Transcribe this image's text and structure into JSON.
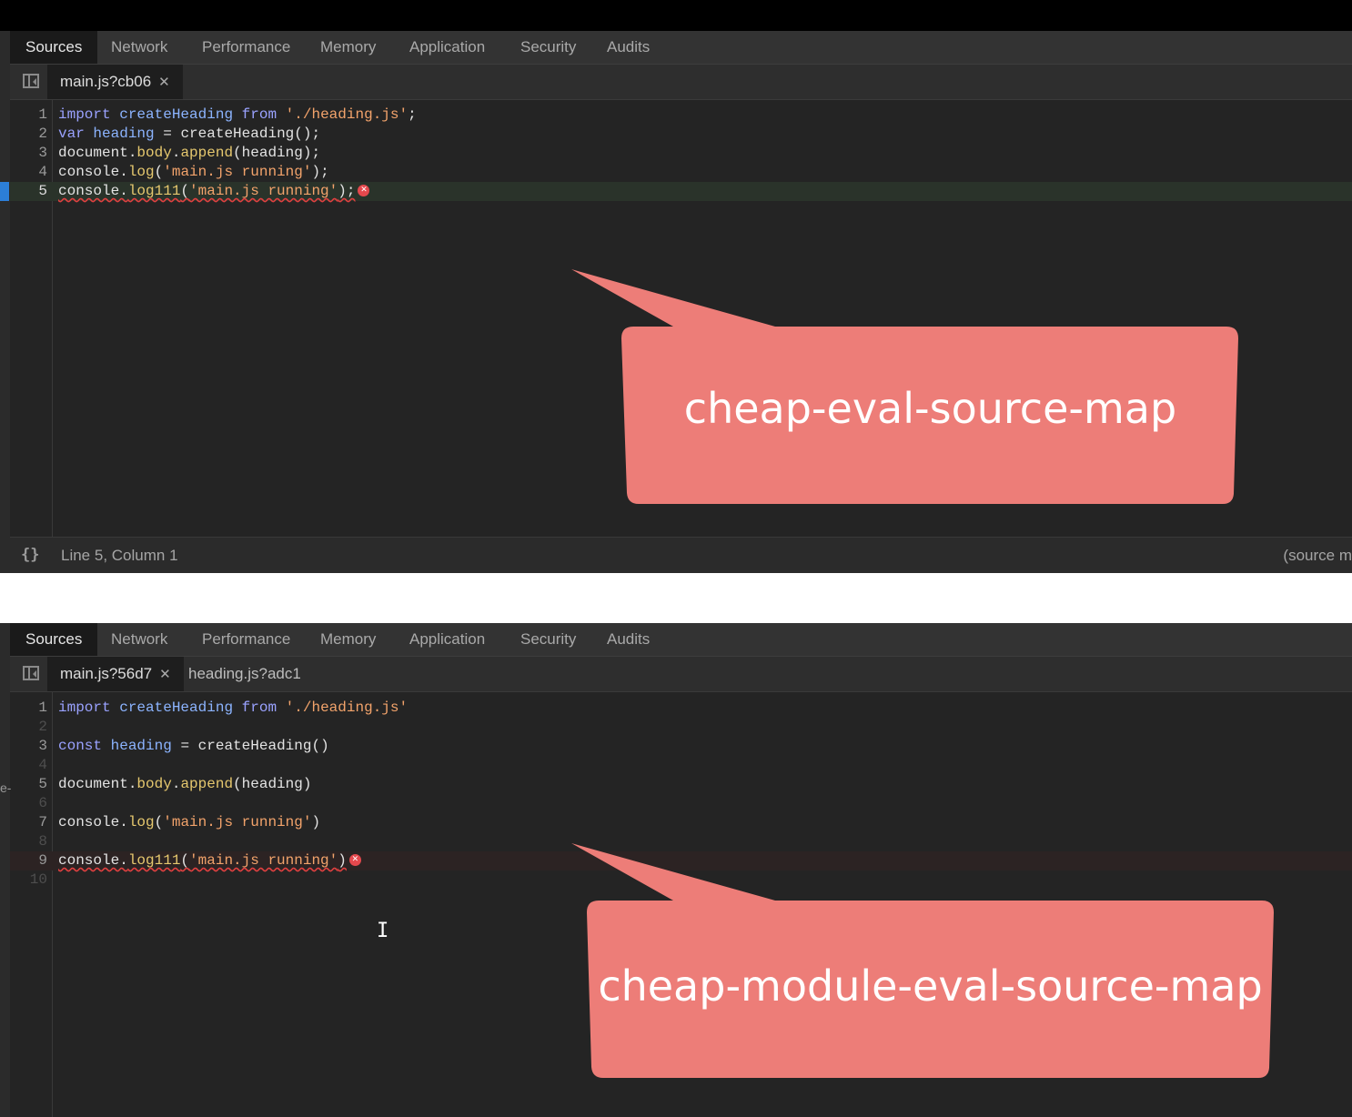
{
  "panels": [
    {
      "tabs": [
        "Sources",
        "Network",
        "Performance",
        "Memory",
        "Application",
        "Security",
        "Audits"
      ],
      "files": [
        "main.js?cb06"
      ],
      "lines": [
        {
          "n": "1",
          "text": "import createHeading from './heading.js';"
        },
        {
          "n": "2",
          "text": "var heading = createHeading();"
        },
        {
          "n": "3",
          "text": "document.body.append(heading);"
        },
        {
          "n": "4",
          "text": "console.log('main.js running');"
        },
        {
          "n": "5",
          "text": "console.log111('main.js running');"
        }
      ],
      "status": "Line 5, Column 1",
      "status_right": "(source m",
      "callout": "cheap-eval-source-map"
    },
    {
      "tabs": [
        "Sources",
        "Network",
        "Performance",
        "Memory",
        "Application",
        "Security",
        "Audits"
      ],
      "files": [
        "main.js?56d7",
        "heading.js?adc1"
      ],
      "lines": [
        {
          "n": "1",
          "text": "import createHeading from './heading.js'"
        },
        {
          "n": "2",
          "text": ""
        },
        {
          "n": "3",
          "text": "const heading = createHeading()"
        },
        {
          "n": "4",
          "text": ""
        },
        {
          "n": "5",
          "text": "document.body.append(heading)"
        },
        {
          "n": "6",
          "text": ""
        },
        {
          "n": "7",
          "text": "console.log('main.js running')"
        },
        {
          "n": "8",
          "text": ""
        },
        {
          "n": "9",
          "text": "console.log111('main.js running')"
        },
        {
          "n": "10",
          "text": ""
        }
      ],
      "callout": "cheap-module-eval-source-map"
    }
  ],
  "side_fragment": "e-",
  "icons": {
    "navigator": "sidebar-toggle-icon",
    "format": "pretty-print-icon",
    "close": "close-icon",
    "error": "error-icon",
    "cursor": "text-cursor-icon"
  },
  "colors": {
    "callout": "#ed7d78",
    "error": "#e5484d",
    "breakpoint": "#2c7ed8"
  }
}
